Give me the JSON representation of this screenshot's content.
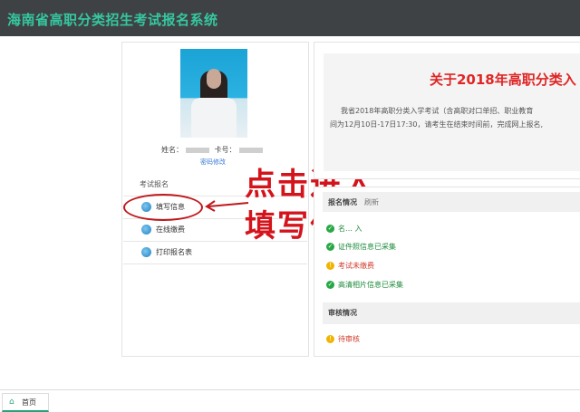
{
  "header": {
    "title": "海南省高职分类招生考试报名系统"
  },
  "profile": {
    "name_label": "姓名：",
    "card_label": "卡号：",
    "change_password": "密码修改"
  },
  "menu": {
    "heading": "考试报名",
    "items": [
      {
        "label": "填写信息",
        "icon": "globe-icon"
      },
      {
        "label": "在线缴费",
        "icon": "globe-icon"
      },
      {
        "label": "打印报名表",
        "icon": "globe-icon"
      }
    ]
  },
  "annotation": {
    "line1": "点击进入",
    "line2": "填写信息",
    "color": "#d4141c"
  },
  "notice": {
    "title": "关于2018年高职分类入",
    "line1": "我省2018年高职分类入学考试（含高职对口单招、职业教育",
    "line2": "间为12月10日-17日17:30，请考生在结束时间前，完成网上报名,"
  },
  "registration": {
    "section_label": "报名情况",
    "refresh": "刷新",
    "partial_item": "名… 入",
    "statuses": [
      {
        "text": "证件照信息已采集",
        "state": "ok"
      },
      {
        "text": "考试未缴费",
        "state": "warn"
      },
      {
        "text": "高清相片信息已采集",
        "state": "ok"
      }
    ]
  },
  "review": {
    "section_label": "审核情况",
    "status": "待审核"
  },
  "tabs": {
    "home": "首页"
  },
  "colors": {
    "accent": "#35c7a0",
    "topbar": "#3f4245",
    "alert": "#e02525"
  }
}
